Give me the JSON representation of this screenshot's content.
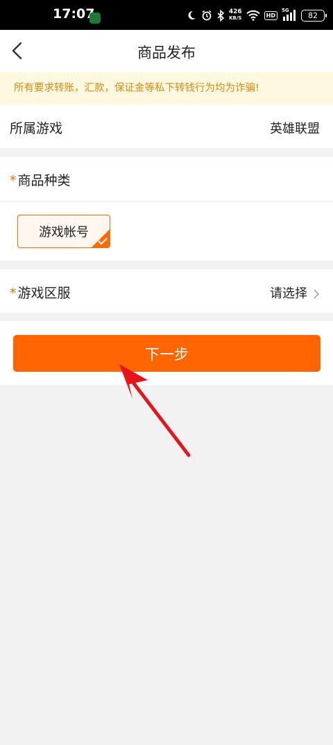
{
  "status_bar": {
    "time": "17:07",
    "network_speed_value": "426",
    "network_speed_unit": "KB/S",
    "hd_label": "HD",
    "signal_label": "5G",
    "battery": "82"
  },
  "nav": {
    "title": "商品发布",
    "back_icon": "chevron-left-icon"
  },
  "notice": {
    "text": "所有要求转账，汇款，保证金等私下转钱行为均为诈骗!"
  },
  "game_row": {
    "label": "所属游戏",
    "value": "英雄联盟"
  },
  "category": {
    "required_mark": "*",
    "label": "商品种类",
    "chip_label": "游戏帐号",
    "chip_selected": true
  },
  "server_row": {
    "required_mark": "*",
    "label": "游戏区服",
    "value": "请选择"
  },
  "next_button": {
    "label": "下一步"
  },
  "colors": {
    "accent": "#ff6503",
    "notice_bg": "#fff8e1",
    "notice_text": "#d98b0e",
    "annotation_arrow": "#e8141c"
  }
}
